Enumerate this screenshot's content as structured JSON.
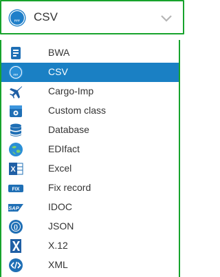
{
  "select": {
    "value": "CSV",
    "icon": "csv-icon"
  },
  "menu": {
    "items": [
      {
        "label": "BWA",
        "icon": "bwa-icon",
        "selected": false
      },
      {
        "label": "CSV",
        "icon": "csv-icon",
        "selected": true
      },
      {
        "label": "Cargo-Imp",
        "icon": "airplane-icon",
        "selected": false
      },
      {
        "label": "Custom class",
        "icon": "custom-class-icon",
        "selected": false
      },
      {
        "label": "Database",
        "icon": "database-icon",
        "selected": false
      },
      {
        "label": "EDIfact",
        "icon": "edifact-icon",
        "selected": false
      },
      {
        "label": "Excel",
        "icon": "excel-icon",
        "selected": false
      },
      {
        "label": "Fix record",
        "icon": "fix-record-icon",
        "selected": false
      },
      {
        "label": "IDOC",
        "icon": "sap-icon",
        "selected": false
      },
      {
        "label": "JSON",
        "icon": "json-icon",
        "selected": false
      },
      {
        "label": "X.12",
        "icon": "x12-icon",
        "selected": false
      },
      {
        "label": "XML",
        "icon": "xml-icon",
        "selected": false
      }
    ]
  },
  "colors": {
    "border": "#17a32c",
    "selected_background": "#1a80c4",
    "text": "#333333"
  }
}
